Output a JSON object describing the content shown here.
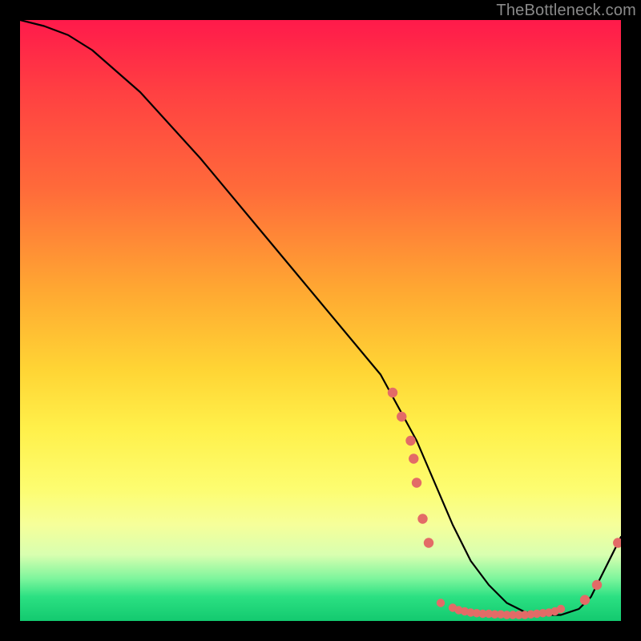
{
  "watermark": "TheBottleneck.com",
  "chart_data": {
    "type": "line",
    "title": "",
    "xlabel": "",
    "ylabel": "",
    "xlim": [
      0,
      100
    ],
    "ylim": [
      0,
      100
    ],
    "grid": false,
    "legend": false,
    "curve": {
      "x": [
        0,
        4,
        8,
        12,
        20,
        30,
        40,
        50,
        60,
        66,
        69,
        72,
        75,
        78,
        81,
        84,
        87,
        90,
        93,
        95,
        97,
        100
      ],
      "y": [
        100,
        99,
        97.5,
        95,
        88,
        77,
        65,
        53,
        41,
        30,
        23,
        16,
        10,
        6,
        3,
        1.5,
        1,
        1,
        2,
        4,
        8,
        14
      ]
    },
    "scatter_clusters": [
      {
        "region": "falling-edge",
        "x": [
          62,
          63.5,
          65,
          65.5,
          66,
          67,
          68
        ],
        "y": [
          38,
          34,
          30,
          27,
          23,
          17,
          13
        ]
      },
      {
        "region": "valley-floor",
        "x": [
          70,
          72,
          73,
          74,
          75,
          76,
          77,
          78,
          79,
          80,
          81,
          82,
          83,
          84,
          85,
          86,
          87,
          88,
          89,
          90
        ],
        "y": [
          3,
          2.2,
          1.8,
          1.6,
          1.4,
          1.3,
          1.2,
          1.2,
          1.1,
          1.1,
          1.0,
          1.0,
          1.0,
          1.0,
          1.1,
          1.2,
          1.3,
          1.4,
          1.6,
          2.0
        ]
      },
      {
        "region": "rising-edge",
        "x": [
          94,
          96,
          99.5
        ],
        "y": [
          3.5,
          6,
          13
        ]
      }
    ],
    "colors": {
      "curve": "#000000",
      "points": "#e36b67"
    }
  }
}
